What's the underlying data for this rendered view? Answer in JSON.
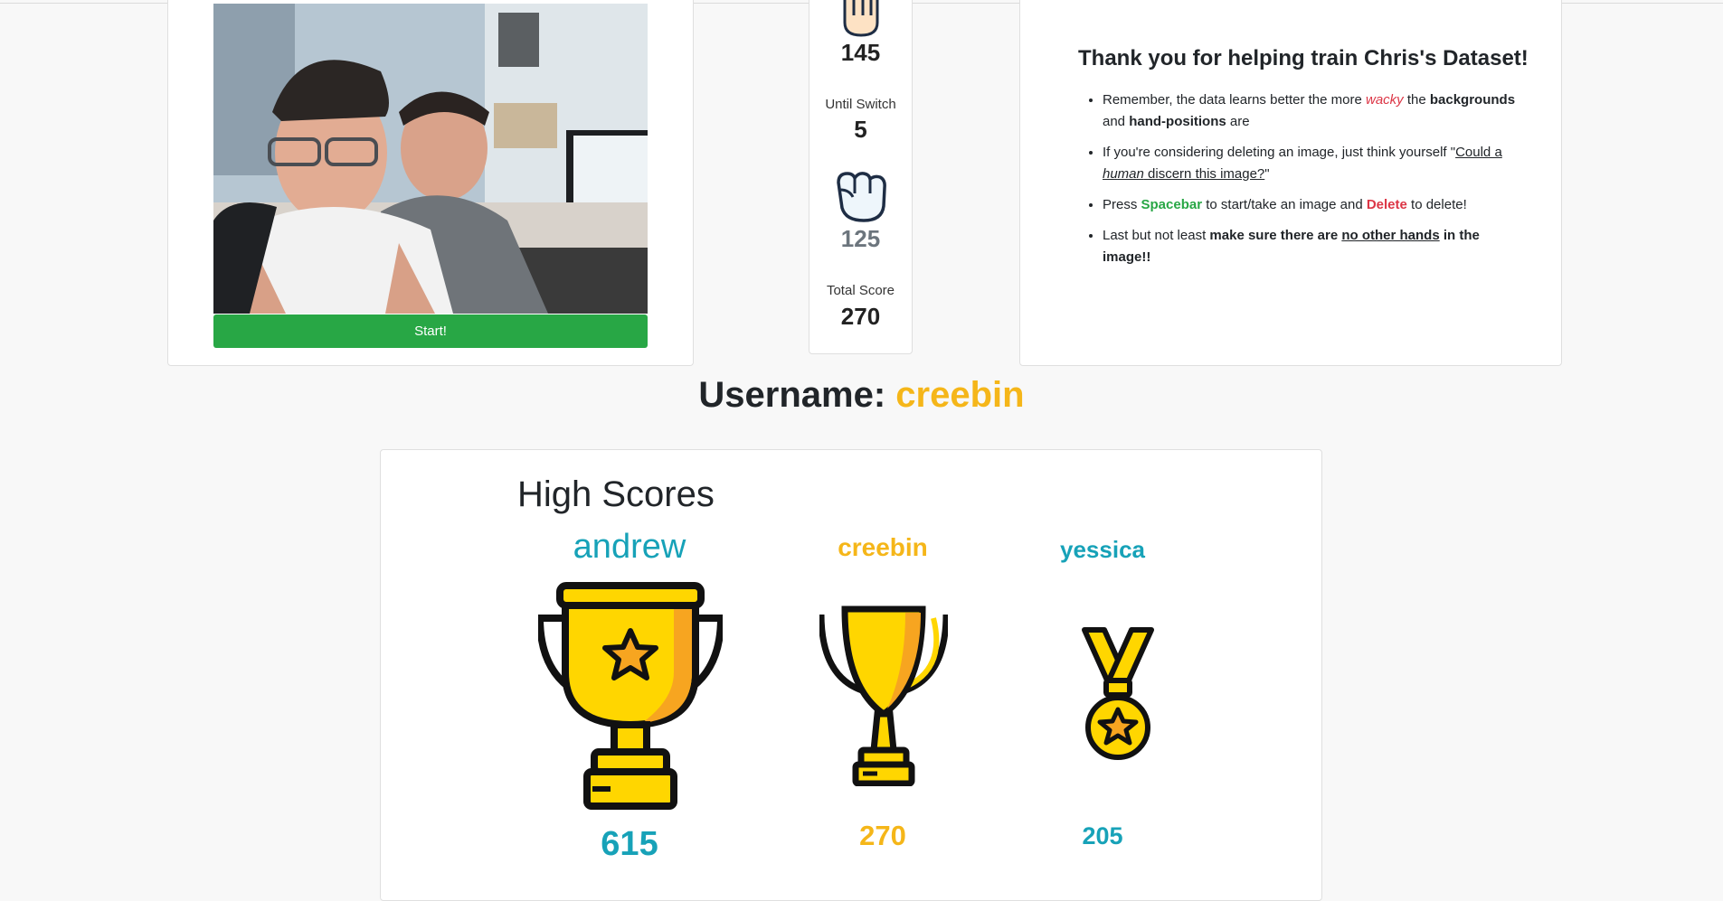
{
  "game": {
    "open_hand_count": "145",
    "until_switch_label": "Until Switch",
    "until_switch_value": "5",
    "fist_count": "125",
    "total_score_label": "Total Score",
    "total_score_value": "270",
    "start_button": "Start!"
  },
  "info": {
    "title": "Thank you for helping train Chris's Dataset!",
    "tip1": {
      "a": "Remember, the data learns better the more ",
      "b": "wacky",
      "c": " the ",
      "d": "backgrounds",
      "e": " and ",
      "f": "hand-positions",
      "g": " are"
    },
    "tip2": {
      "a": "If you're considering deleting an image, just think yourself \"",
      "b": "Could a ",
      "c": "human",
      "d": " discern this image?",
      "e": "\""
    },
    "tip3": {
      "a": "Press ",
      "b": "Spacebar",
      "c": " to start/take an image and ",
      "d": "Delete",
      "e": " to delete!"
    },
    "tip4": {
      "a": "Last but not least ",
      "b": "make sure there are ",
      "c": "no other hands",
      "d": " in the image!!"
    }
  },
  "username": {
    "label": "Username: ",
    "value": "creebin"
  },
  "high_scores": {
    "title": "High Scores",
    "entries": [
      {
        "name": "andrew",
        "score": "615",
        "color": "#17a2b8",
        "icon": "large-trophy-icon"
      },
      {
        "name": "creebin",
        "score": "270",
        "color": "#f5b619",
        "icon": "cup-trophy-icon"
      },
      {
        "name": "yessica",
        "score": "205",
        "color": "#17a2b8",
        "icon": "medal-icon"
      }
    ]
  },
  "colors": {
    "accent_green": "#28a745",
    "accent_red": "#dc3545",
    "gold": "#f5b619",
    "teal": "#17a2b8"
  }
}
